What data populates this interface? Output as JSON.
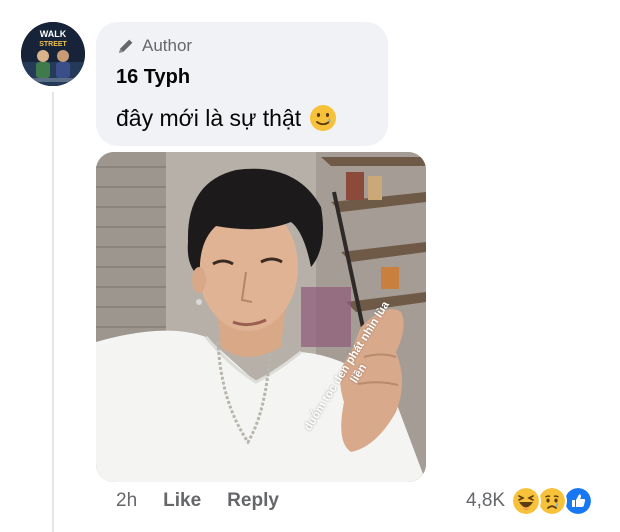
{
  "comment": {
    "badge": {
      "icon": "pen-icon",
      "label": "Author"
    },
    "author": "16 Typh",
    "text": "đây mới là sự thật",
    "emoji": "smiling-face-with-tear-icon",
    "photo_caption": "duỗm tóc đen phát nhìn lùa liền"
  },
  "avatar": {
    "text_line1": "WALK",
    "text_line2": "STREET"
  },
  "actions": {
    "time": "2h",
    "like_label": "Like",
    "reply_label": "Reply"
  },
  "reactions": {
    "count": "4,8K",
    "icons": [
      "haha-icon",
      "sad-icon",
      "like-icon"
    ]
  },
  "colors": {
    "bubble_bg": "#f0f2f5",
    "secondary_text": "#65676b",
    "primary_text": "#050505",
    "like_blue": "#1877f2",
    "reaction_yellow": "#f7c13a"
  }
}
